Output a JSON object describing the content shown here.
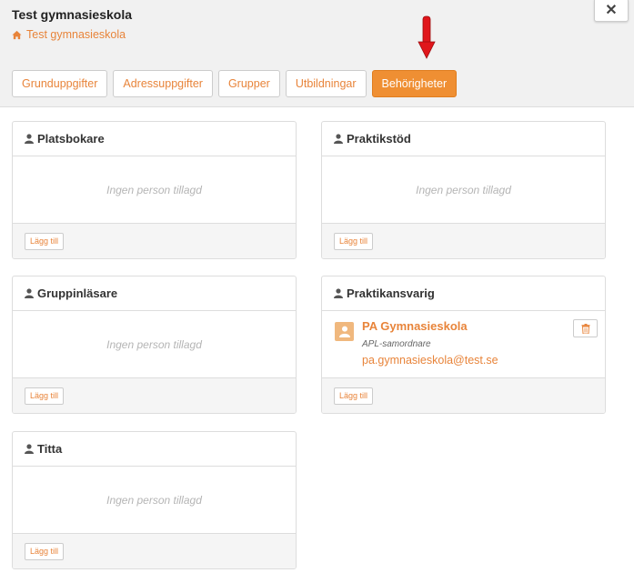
{
  "header": {
    "title": "Test gymnasieskola",
    "breadcrumb": "Test gymnasieskola",
    "close_label": "✕"
  },
  "tabs": [
    {
      "label": "Grunduppgifter",
      "active": false
    },
    {
      "label": "Adressuppgifter",
      "active": false
    },
    {
      "label": "Grupper",
      "active": false
    },
    {
      "label": "Utbildningar",
      "active": false
    },
    {
      "label": "Behörigheter",
      "active": true
    }
  ],
  "panels": {
    "platsbokare": {
      "title": "Platsbokare",
      "empty": "Ingen person tillagd",
      "add": "Lägg till"
    },
    "praktikstod": {
      "title": "Praktikstöd",
      "empty": "Ingen person tillagd",
      "add": "Lägg till"
    },
    "gruppinlasare": {
      "title": "Gruppinläsare",
      "empty": "Ingen person tillagd",
      "add": "Lägg till"
    },
    "praktikansvarig": {
      "title": "Praktikansvarig",
      "add": "Lägg till",
      "person": {
        "name": "PA Gymnasieskola",
        "role": "APL-samordnare",
        "email": "pa.gymnasieskola@test.se"
      }
    },
    "titta": {
      "title": "Titta",
      "empty": "Ingen person tillagd",
      "add": "Lägg till"
    }
  },
  "colors": {
    "accent": "#e8843a",
    "active_tab": "#ef8f33",
    "arrow": "#e0161b"
  }
}
